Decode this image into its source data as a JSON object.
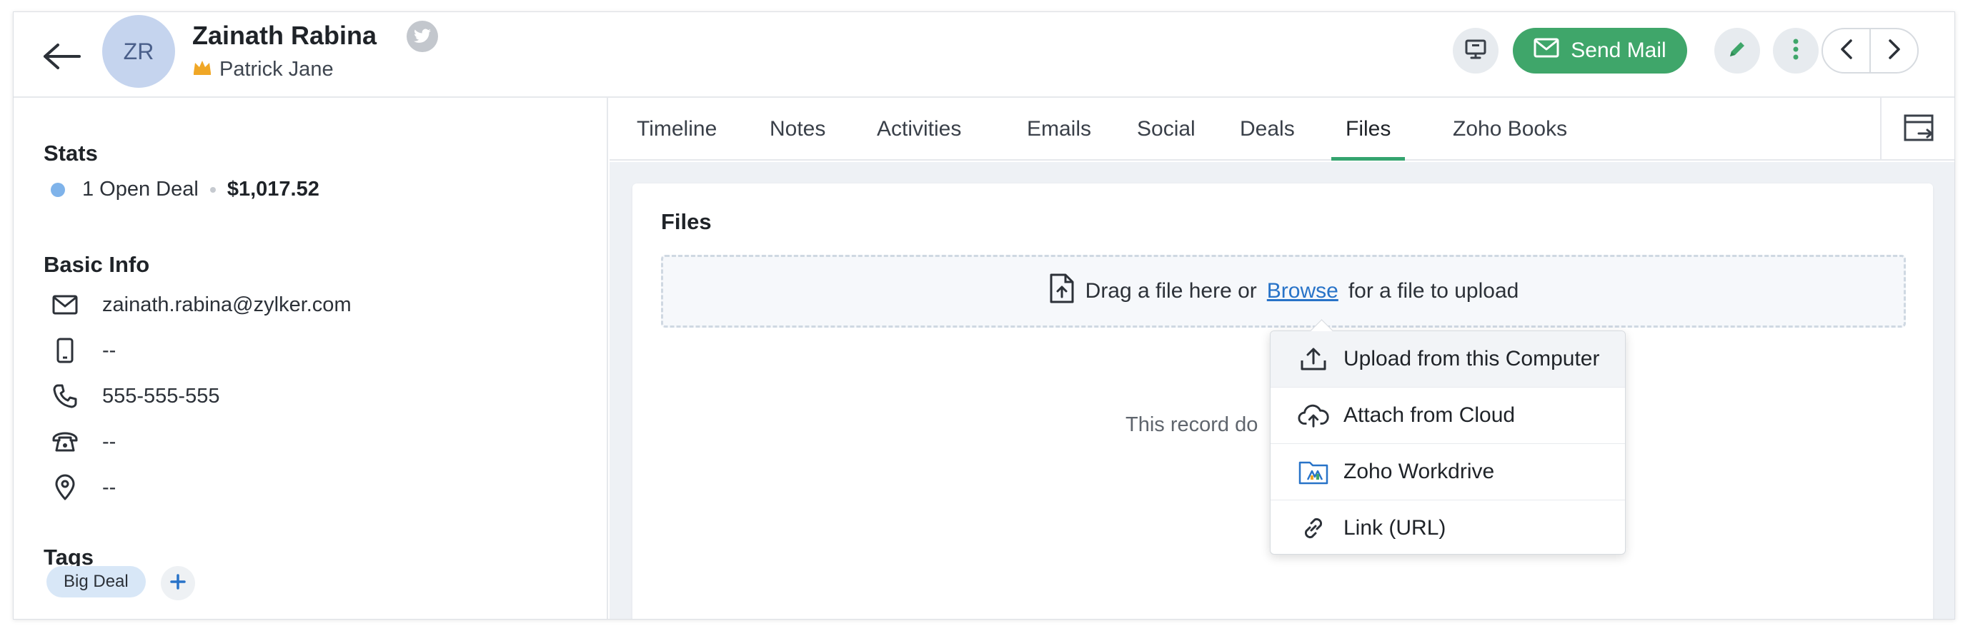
{
  "header": {
    "avatar_initials": "ZR",
    "record_name": "Zainath Rabina",
    "owner_name": "Patrick Jane",
    "send_mail_label": "Send Mail"
  },
  "sidebar": {
    "stats": {
      "title": "Stats",
      "open_deals": "1 Open Deal",
      "amount": "$1,017.52"
    },
    "basic_info": {
      "title": "Basic Info",
      "email": "zainath.rabina@zylker.com",
      "mobile": "--",
      "phone": "555-555-555",
      "home_phone": "--",
      "address": "--"
    },
    "tags": {
      "title": "Tags",
      "items": [
        "Big Deal"
      ]
    }
  },
  "tabs": [
    {
      "label": "Timeline"
    },
    {
      "label": "Notes"
    },
    {
      "label": "Activities"
    },
    {
      "label": "Emails"
    },
    {
      "label": "Social"
    },
    {
      "label": "Deals"
    },
    {
      "label": "Files",
      "active": true
    },
    {
      "label": "Zoho Books"
    }
  ],
  "files": {
    "title": "Files",
    "drop_before": "Drag a file here or",
    "browse_label": "Browse",
    "drop_after": "for a file to upload",
    "empty_text": "This record do"
  },
  "upload_menu": {
    "items": [
      {
        "label": "Upload from this Computer",
        "icon": "upload-icon"
      },
      {
        "label": "Attach from Cloud",
        "icon": "cloud-upload-icon"
      },
      {
        "label": "Zoho Workdrive",
        "icon": "workdrive-icon"
      },
      {
        "label": "Link (URL)",
        "icon": "link-icon"
      }
    ]
  },
  "colors": {
    "accent_green": "#3fa66a",
    "link_blue": "#2873c8",
    "avatar_bg": "#c5d4ee",
    "deal_dot": "#7fb3ea"
  }
}
